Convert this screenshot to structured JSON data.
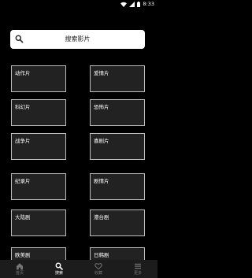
{
  "status_bar": {
    "time": "8:33",
    "icons": [
      "wifi-icon",
      "cellular-icon",
      "battery-icon"
    ]
  },
  "search": {
    "icon": "search-icon",
    "placeholder": "搜索影片"
  },
  "categories": [
    "动作片",
    "爱情片",
    "科幻片",
    "恐怖片",
    "战争片",
    "喜剧片",
    "纪录片",
    "剧情片",
    "大陆剧",
    "港台剧",
    "欧美剧",
    "日韩剧"
  ],
  "bottom_nav": {
    "items": [
      {
        "label": "首页",
        "icon": "home-icon",
        "active": false
      },
      {
        "label": "搜索",
        "icon": "search-icon",
        "active": true
      },
      {
        "label": "收藏",
        "icon": "heart-icon",
        "active": false
      },
      {
        "label": "更多",
        "icon": "menu-icon",
        "active": false
      }
    ]
  },
  "colors": {
    "background": "#000000",
    "card": "#222222",
    "card_border": "#bdbdbd",
    "nav_bar": "#1c1c1c",
    "nav_active": "#ffffff",
    "nav_inactive": "#777777"
  }
}
